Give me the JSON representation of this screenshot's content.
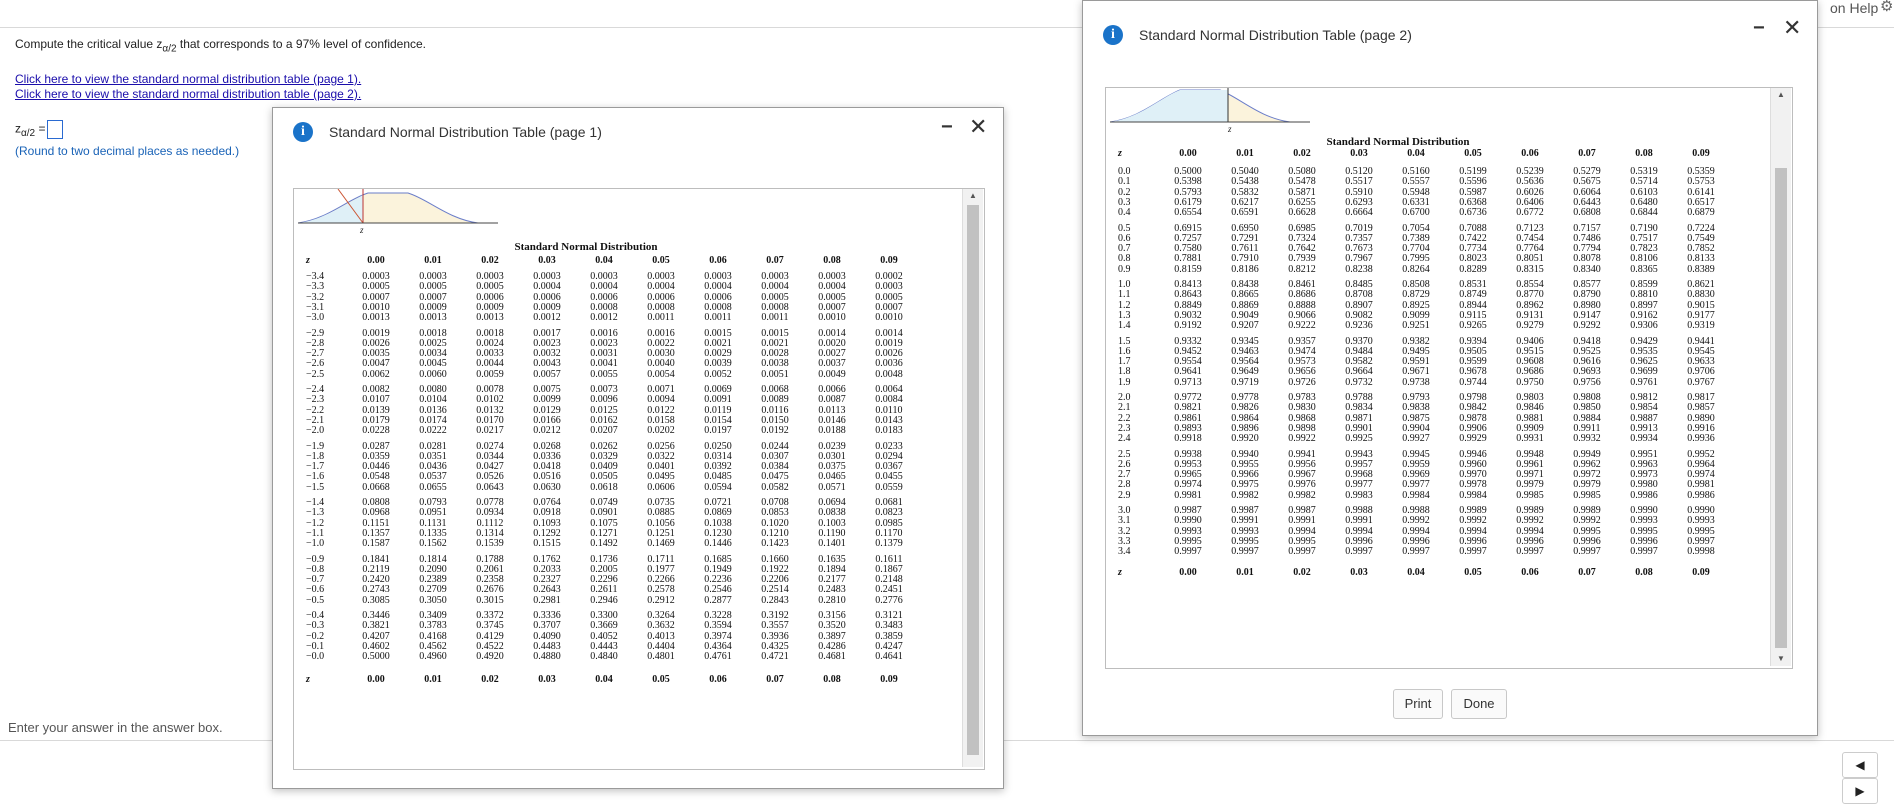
{
  "topbar": {
    "help_label": "on Help",
    "gear_icon": "gear-icon"
  },
  "question": {
    "prefix": "Compute the critical value z",
    "subscript": "α/2",
    "suffix": " that corresponds to a 97% level of confidence."
  },
  "links": {
    "page1": "Click here to view the standard normal distribution table (page 1).",
    "page2": "Click here to view the standard normal distribution table (page 2)."
  },
  "answer": {
    "symbol": "z",
    "subscript": "α/2",
    "equals": " =",
    "note": "(Round to two decimal places as needed.)"
  },
  "footer": {
    "enter_text": "Enter your answer in the answer box.",
    "back_icon": "back-arrow-icon",
    "forward_icon": "forward-arrow-icon"
  },
  "dialog1": {
    "title": "Standard Normal Distribution Table (page 1)",
    "table_title": "Standard Normal Distribution",
    "curve_label": "z",
    "z_header": "z",
    "columns": [
      "0.00",
      "0.01",
      "0.02",
      "0.03",
      "0.04",
      "0.05",
      "0.06",
      "0.07",
      "0.08",
      "0.09"
    ],
    "rows": [
      [
        "−3.4",
        "0.0003",
        "0.0003",
        "0.0003",
        "0.0003",
        "0.0003",
        "0.0003",
        "0.0003",
        "0.0003",
        "0.0003",
        "0.0002"
      ],
      [
        "−3.3",
        "0.0005",
        "0.0005",
        "0.0005",
        "0.0004",
        "0.0004",
        "0.0004",
        "0.0004",
        "0.0004",
        "0.0004",
        "0.0003"
      ],
      [
        "−3.2",
        "0.0007",
        "0.0007",
        "0.0006",
        "0.0006",
        "0.0006",
        "0.0006",
        "0.0006",
        "0.0005",
        "0.0005",
        "0.0005"
      ],
      [
        "−3.1",
        "0.0010",
        "0.0009",
        "0.0009",
        "0.0009",
        "0.0008",
        "0.0008",
        "0.0008",
        "0.0008",
        "0.0007",
        "0.0007"
      ],
      [
        "−3.0",
        "0.0013",
        "0.0013",
        "0.0013",
        "0.0012",
        "0.0012",
        "0.0011",
        "0.0011",
        "0.0011",
        "0.0010",
        "0.0010"
      ],
      [
        "−2.9",
        "0.0019",
        "0.0018",
        "0.0018",
        "0.0017",
        "0.0016",
        "0.0016",
        "0.0015",
        "0.0015",
        "0.0014",
        "0.0014"
      ],
      [
        "−2.8",
        "0.0026",
        "0.0025",
        "0.0024",
        "0.0023",
        "0.0023",
        "0.0022",
        "0.0021",
        "0.0021",
        "0.0020",
        "0.0019"
      ],
      [
        "−2.7",
        "0.0035",
        "0.0034",
        "0.0033",
        "0.0032",
        "0.0031",
        "0.0030",
        "0.0029",
        "0.0028",
        "0.0027",
        "0.0026"
      ],
      [
        "−2.6",
        "0.0047",
        "0.0045",
        "0.0044",
        "0.0043",
        "0.0041",
        "0.0040",
        "0.0039",
        "0.0038",
        "0.0037",
        "0.0036"
      ],
      [
        "−2.5",
        "0.0062",
        "0.0060",
        "0.0059",
        "0.0057",
        "0.0055",
        "0.0054",
        "0.0052",
        "0.0051",
        "0.0049",
        "0.0048"
      ],
      [
        "−2.4",
        "0.0082",
        "0.0080",
        "0.0078",
        "0.0075",
        "0.0073",
        "0.0071",
        "0.0069",
        "0.0068",
        "0.0066",
        "0.0064"
      ],
      [
        "−2.3",
        "0.0107",
        "0.0104",
        "0.0102",
        "0.0099",
        "0.0096",
        "0.0094",
        "0.0091",
        "0.0089",
        "0.0087",
        "0.0084"
      ],
      [
        "−2.2",
        "0.0139",
        "0.0136",
        "0.0132",
        "0.0129",
        "0.0125",
        "0.0122",
        "0.0119",
        "0.0116",
        "0.0113",
        "0.0110"
      ],
      [
        "−2.1",
        "0.0179",
        "0.0174",
        "0.0170",
        "0.0166",
        "0.0162",
        "0.0158",
        "0.0154",
        "0.0150",
        "0.0146",
        "0.0143"
      ],
      [
        "−2.0",
        "0.0228",
        "0.0222",
        "0.0217",
        "0.0212",
        "0.0207",
        "0.0202",
        "0.0197",
        "0.0192",
        "0.0188",
        "0.0183"
      ],
      [
        "−1.9",
        "0.0287",
        "0.0281",
        "0.0274",
        "0.0268",
        "0.0262",
        "0.0256",
        "0.0250",
        "0.0244",
        "0.0239",
        "0.0233"
      ],
      [
        "−1.8",
        "0.0359",
        "0.0351",
        "0.0344",
        "0.0336",
        "0.0329",
        "0.0322",
        "0.0314",
        "0.0307",
        "0.0301",
        "0.0294"
      ],
      [
        "−1.7",
        "0.0446",
        "0.0436",
        "0.0427",
        "0.0418",
        "0.0409",
        "0.0401",
        "0.0392",
        "0.0384",
        "0.0375",
        "0.0367"
      ],
      [
        "−1.6",
        "0.0548",
        "0.0537",
        "0.0526",
        "0.0516",
        "0.0505",
        "0.0495",
        "0.0485",
        "0.0475",
        "0.0465",
        "0.0455"
      ],
      [
        "−1.5",
        "0.0668",
        "0.0655",
        "0.0643",
        "0.0630",
        "0.0618",
        "0.0606",
        "0.0594",
        "0.0582",
        "0.0571",
        "0.0559"
      ],
      [
        "−1.4",
        "0.0808",
        "0.0793",
        "0.0778",
        "0.0764",
        "0.0749",
        "0.0735",
        "0.0721",
        "0.0708",
        "0.0694",
        "0.0681"
      ],
      [
        "−1.3",
        "0.0968",
        "0.0951",
        "0.0934",
        "0.0918",
        "0.0901",
        "0.0885",
        "0.0869",
        "0.0853",
        "0.0838",
        "0.0823"
      ],
      [
        "−1.2",
        "0.1151",
        "0.1131",
        "0.1112",
        "0.1093",
        "0.1075",
        "0.1056",
        "0.1038",
        "0.1020",
        "0.1003",
        "0.0985"
      ],
      [
        "−1.1",
        "0.1357",
        "0.1335",
        "0.1314",
        "0.1292",
        "0.1271",
        "0.1251",
        "0.1230",
        "0.1210",
        "0.1190",
        "0.1170"
      ],
      [
        "−1.0",
        "0.1587",
        "0.1562",
        "0.1539",
        "0.1515",
        "0.1492",
        "0.1469",
        "0.1446",
        "0.1423",
        "0.1401",
        "0.1379"
      ],
      [
        "−0.9",
        "0.1841",
        "0.1814",
        "0.1788",
        "0.1762",
        "0.1736",
        "0.1711",
        "0.1685",
        "0.1660",
        "0.1635",
        "0.1611"
      ],
      [
        "−0.8",
        "0.2119",
        "0.2090",
        "0.2061",
        "0.2033",
        "0.2005",
        "0.1977",
        "0.1949",
        "0.1922",
        "0.1894",
        "0.1867"
      ],
      [
        "−0.7",
        "0.2420",
        "0.2389",
        "0.2358",
        "0.2327",
        "0.2296",
        "0.2266",
        "0.2236",
        "0.2206",
        "0.2177",
        "0.2148"
      ],
      [
        "−0.6",
        "0.2743",
        "0.2709",
        "0.2676",
        "0.2643",
        "0.2611",
        "0.2578",
        "0.2546",
        "0.2514",
        "0.2483",
        "0.2451"
      ],
      [
        "−0.5",
        "0.3085",
        "0.3050",
        "0.3015",
        "0.2981",
        "0.2946",
        "0.2912",
        "0.2877",
        "0.2843",
        "0.2810",
        "0.2776"
      ],
      [
        "−0.4",
        "0.3446",
        "0.3409",
        "0.3372",
        "0.3336",
        "0.3300",
        "0.3264",
        "0.3228",
        "0.3192",
        "0.3156",
        "0.3121"
      ],
      [
        "−0.3",
        "0.3821",
        "0.3783",
        "0.3745",
        "0.3707",
        "0.3669",
        "0.3632",
        "0.3594",
        "0.3557",
        "0.3520",
        "0.3483"
      ],
      [
        "−0.2",
        "0.4207",
        "0.4168",
        "0.4129",
        "0.4090",
        "0.4052",
        "0.4013",
        "0.3974",
        "0.3936",
        "0.3897",
        "0.3859"
      ],
      [
        "−0.1",
        "0.4602",
        "0.4562",
        "0.4522",
        "0.4483",
        "0.4443",
        "0.4404",
        "0.4364",
        "0.4325",
        "0.4286",
        "0.4247"
      ],
      [
        "−0.0",
        "0.5000",
        "0.4960",
        "0.4920",
        "0.4880",
        "0.4840",
        "0.4801",
        "0.4761",
        "0.4721",
        "0.4681",
        "0.4641"
      ]
    ]
  },
  "dialog2": {
    "title": "Standard Normal Distribution Table (page 2)",
    "table_title": "Standard Normal Distribution",
    "curve_label": "z",
    "z_header": "z",
    "columns": [
      "0.00",
      "0.01",
      "0.02",
      "0.03",
      "0.04",
      "0.05",
      "0.06",
      "0.07",
      "0.08",
      "0.09"
    ],
    "rows": [
      [
        "0.0",
        "0.5000",
        "0.5040",
        "0.5080",
        "0.5120",
        "0.5160",
        "0.5199",
        "0.5239",
        "0.5279",
        "0.5319",
        "0.5359"
      ],
      [
        "0.1",
        "0.5398",
        "0.5438",
        "0.5478",
        "0.5517",
        "0.5557",
        "0.5596",
        "0.5636",
        "0.5675",
        "0.5714",
        "0.5753"
      ],
      [
        "0.2",
        "0.5793",
        "0.5832",
        "0.5871",
        "0.5910",
        "0.5948",
        "0.5987",
        "0.6026",
        "0.6064",
        "0.6103",
        "0.6141"
      ],
      [
        "0.3",
        "0.6179",
        "0.6217",
        "0.6255",
        "0.6293",
        "0.6331",
        "0.6368",
        "0.6406",
        "0.6443",
        "0.6480",
        "0.6517"
      ],
      [
        "0.4",
        "0.6554",
        "0.6591",
        "0.6628",
        "0.6664",
        "0.6700",
        "0.6736",
        "0.6772",
        "0.6808",
        "0.6844",
        "0.6879"
      ],
      [
        "0.5",
        "0.6915",
        "0.6950",
        "0.6985",
        "0.7019",
        "0.7054",
        "0.7088",
        "0.7123",
        "0.7157",
        "0.7190",
        "0.7224"
      ],
      [
        "0.6",
        "0.7257",
        "0.7291",
        "0.7324",
        "0.7357",
        "0.7389",
        "0.7422",
        "0.7454",
        "0.7486",
        "0.7517",
        "0.7549"
      ],
      [
        "0.7",
        "0.7580",
        "0.7611",
        "0.7642",
        "0.7673",
        "0.7704",
        "0.7734",
        "0.7764",
        "0.7794",
        "0.7823",
        "0.7852"
      ],
      [
        "0.8",
        "0.7881",
        "0.7910",
        "0.7939",
        "0.7967",
        "0.7995",
        "0.8023",
        "0.8051",
        "0.8078",
        "0.8106",
        "0.8133"
      ],
      [
        "0.9",
        "0.8159",
        "0.8186",
        "0.8212",
        "0.8238",
        "0.8264",
        "0.8289",
        "0.8315",
        "0.8340",
        "0.8365",
        "0.8389"
      ],
      [
        "1.0",
        "0.8413",
        "0.8438",
        "0.8461",
        "0.8485",
        "0.8508",
        "0.8531",
        "0.8554",
        "0.8577",
        "0.8599",
        "0.8621"
      ],
      [
        "1.1",
        "0.8643",
        "0.8665",
        "0.8686",
        "0.8708",
        "0.8729",
        "0.8749",
        "0.8770",
        "0.8790",
        "0.8810",
        "0.8830"
      ],
      [
        "1.2",
        "0.8849",
        "0.8869",
        "0.8888",
        "0.8907",
        "0.8925",
        "0.8944",
        "0.8962",
        "0.8980",
        "0.8997",
        "0.9015"
      ],
      [
        "1.3",
        "0.9032",
        "0.9049",
        "0.9066",
        "0.9082",
        "0.9099",
        "0.9115",
        "0.9131",
        "0.9147",
        "0.9162",
        "0.9177"
      ],
      [
        "1.4",
        "0.9192",
        "0.9207",
        "0.9222",
        "0.9236",
        "0.9251",
        "0.9265",
        "0.9279",
        "0.9292",
        "0.9306",
        "0.9319"
      ],
      [
        "1.5",
        "0.9332",
        "0.9345",
        "0.9357",
        "0.9370",
        "0.9382",
        "0.9394",
        "0.9406",
        "0.9418",
        "0.9429",
        "0.9441"
      ],
      [
        "1.6",
        "0.9452",
        "0.9463",
        "0.9474",
        "0.9484",
        "0.9495",
        "0.9505",
        "0.9515",
        "0.9525",
        "0.9535",
        "0.9545"
      ],
      [
        "1.7",
        "0.9554",
        "0.9564",
        "0.9573",
        "0.9582",
        "0.9591",
        "0.9599",
        "0.9608",
        "0.9616",
        "0.9625",
        "0.9633"
      ],
      [
        "1.8",
        "0.9641",
        "0.9649",
        "0.9656",
        "0.9664",
        "0.9671",
        "0.9678",
        "0.9686",
        "0.9693",
        "0.9699",
        "0.9706"
      ],
      [
        "1.9",
        "0.9713",
        "0.9719",
        "0.9726",
        "0.9732",
        "0.9738",
        "0.9744",
        "0.9750",
        "0.9756",
        "0.9761",
        "0.9767"
      ],
      [
        "2.0",
        "0.9772",
        "0.9778",
        "0.9783",
        "0.9788",
        "0.9793",
        "0.9798",
        "0.9803",
        "0.9808",
        "0.9812",
        "0.9817"
      ],
      [
        "2.1",
        "0.9821",
        "0.9826",
        "0.9830",
        "0.9834",
        "0.9838",
        "0.9842",
        "0.9846",
        "0.9850",
        "0.9854",
        "0.9857"
      ],
      [
        "2.2",
        "0.9861",
        "0.9864",
        "0.9868",
        "0.9871",
        "0.9875",
        "0.9878",
        "0.9881",
        "0.9884",
        "0.9887",
        "0.9890"
      ],
      [
        "2.3",
        "0.9893",
        "0.9896",
        "0.9898",
        "0.9901",
        "0.9904",
        "0.9906",
        "0.9909",
        "0.9911",
        "0.9913",
        "0.9916"
      ],
      [
        "2.4",
        "0.9918",
        "0.9920",
        "0.9922",
        "0.9925",
        "0.9927",
        "0.9929",
        "0.9931",
        "0.9932",
        "0.9934",
        "0.9936"
      ],
      [
        "2.5",
        "0.9938",
        "0.9940",
        "0.9941",
        "0.9943",
        "0.9945",
        "0.9946",
        "0.9948",
        "0.9949",
        "0.9951",
        "0.9952"
      ],
      [
        "2.6",
        "0.9953",
        "0.9955",
        "0.9956",
        "0.9957",
        "0.9959",
        "0.9960",
        "0.9961",
        "0.9962",
        "0.9963",
        "0.9964"
      ],
      [
        "2.7",
        "0.9965",
        "0.9966",
        "0.9967",
        "0.9968",
        "0.9969",
        "0.9970",
        "0.9971",
        "0.9972",
        "0.9973",
        "0.9974"
      ],
      [
        "2.8",
        "0.9974",
        "0.9975",
        "0.9976",
        "0.9977",
        "0.9977",
        "0.9978",
        "0.9979",
        "0.9979",
        "0.9980",
        "0.9981"
      ],
      [
        "2.9",
        "0.9981",
        "0.9982",
        "0.9982",
        "0.9983",
        "0.9984",
        "0.9984",
        "0.9985",
        "0.9985",
        "0.9986",
        "0.9986"
      ],
      [
        "3.0",
        "0.9987",
        "0.9987",
        "0.9987",
        "0.9988",
        "0.9988",
        "0.9989",
        "0.9989",
        "0.9989",
        "0.9990",
        "0.9990"
      ],
      [
        "3.1",
        "0.9990",
        "0.9991",
        "0.9991",
        "0.9991",
        "0.9992",
        "0.9992",
        "0.9992",
        "0.9992",
        "0.9993",
        "0.9993"
      ],
      [
        "3.2",
        "0.9993",
        "0.9993",
        "0.9994",
        "0.9994",
        "0.9994",
        "0.9994",
        "0.9994",
        "0.9995",
        "0.9995",
        "0.9995"
      ],
      [
        "3.3",
        "0.9995",
        "0.9995",
        "0.9995",
        "0.9996",
        "0.9996",
        "0.9996",
        "0.9996",
        "0.9996",
        "0.9996",
        "0.9997"
      ],
      [
        "3.4",
        "0.9997",
        "0.9997",
        "0.9997",
        "0.9997",
        "0.9997",
        "0.9997",
        "0.9997",
        "0.9997",
        "0.9997",
        "0.9998"
      ]
    ],
    "print_label": "Print",
    "done_label": "Done"
  }
}
